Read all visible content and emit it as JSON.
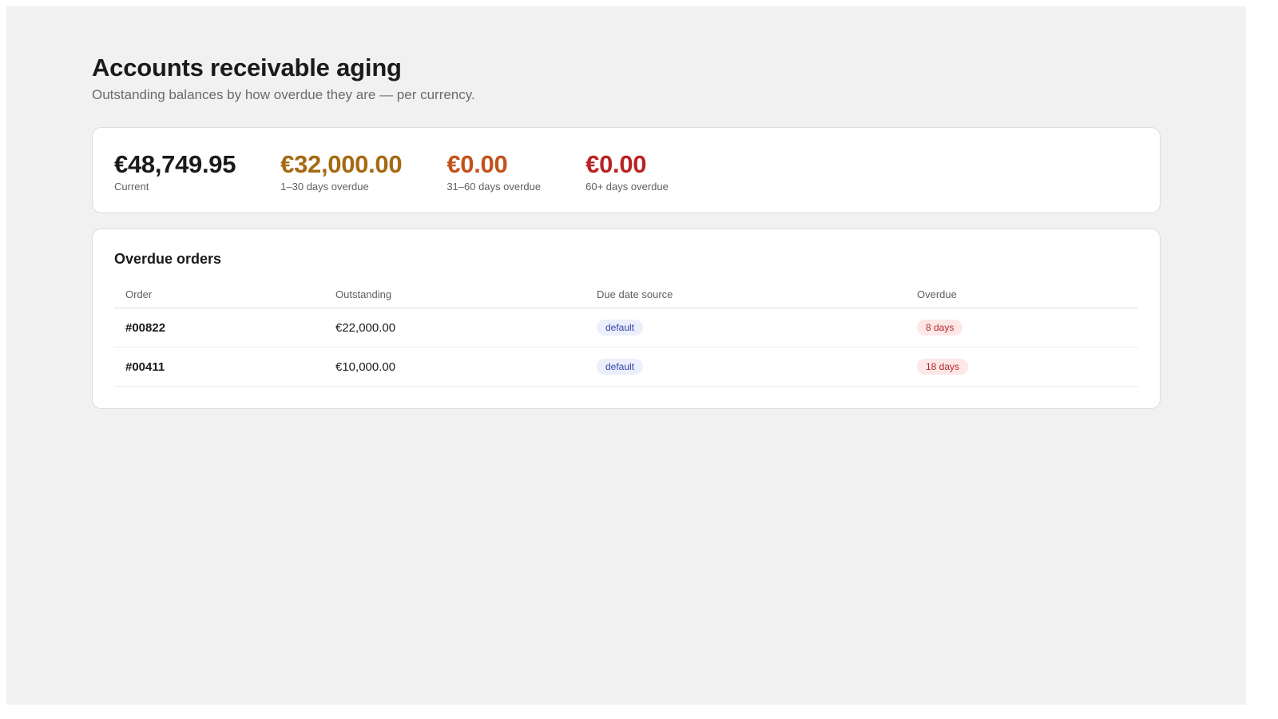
{
  "page": {
    "title": "Accounts receivable aging",
    "subtitle": "Outstanding balances by how overdue they are — per currency."
  },
  "summary": {
    "buckets": [
      {
        "value": "€48,749.95",
        "label": "Current",
        "color": "#1a1a1a"
      },
      {
        "value": "€32,000.00",
        "label": "1–30 days overdue",
        "color": "#a56a12"
      },
      {
        "value": "€0.00",
        "label": "31–60 days overdue",
        "color": "#c2531b"
      },
      {
        "value": "€0.00",
        "label": "60+ days overdue",
        "color": "#b82424"
      }
    ]
  },
  "orders": {
    "title": "Overdue orders",
    "columns": [
      "Order",
      "Outstanding",
      "Due date source",
      "Overdue"
    ],
    "rows": [
      {
        "order": "#00822",
        "outstanding": "€22,000.00",
        "source": "default",
        "overdue": "8 days"
      },
      {
        "order": "#00411",
        "outstanding": "€10,000.00",
        "source": "default",
        "overdue": "18 days"
      }
    ]
  },
  "colors": {
    "source_badge_bg": "#eceffb",
    "source_badge_text": "#3044a8",
    "overdue_badge_bg": "#fde7e7",
    "overdue_badge_text": "#b22a2a"
  }
}
